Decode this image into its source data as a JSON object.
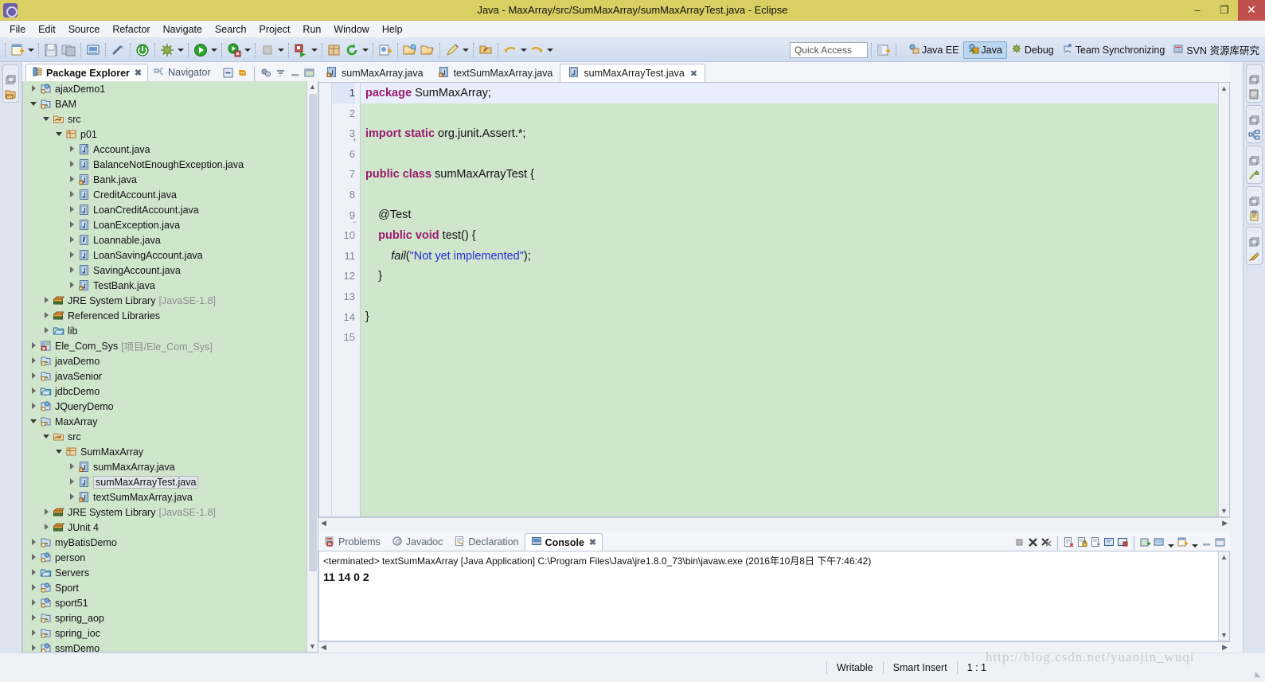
{
  "window": {
    "title": "Java - MaxArray/src/SumMaxArray/sumMaxArrayTest.java - Eclipse",
    "minimize": "–",
    "restore": "❐",
    "close": "✕"
  },
  "menubar": {
    "items": [
      "File",
      "Edit",
      "Source",
      "Refactor",
      "Navigate",
      "Search",
      "Project",
      "Run",
      "Window",
      "Help"
    ]
  },
  "toolbar": {
    "quick_access_placeholder": "Quick Access",
    "perspectives": [
      {
        "label": "Java EE",
        "active": false
      },
      {
        "label": "Java",
        "active": true
      },
      {
        "label": "Debug",
        "active": false
      },
      {
        "label": "Team Synchronizing",
        "active": false
      },
      {
        "label": "SVN 资源库研究",
        "active": false
      }
    ]
  },
  "left_panel": {
    "tabs": [
      {
        "label": "Package Explorer",
        "active": true,
        "closable": true
      },
      {
        "label": "Navigator",
        "active": false,
        "closable": false
      }
    ],
    "tree": [
      {
        "label": "ajaxDemo1",
        "indent": 0,
        "twisty": "closed",
        "icon": "web-project-icon"
      },
      {
        "label": "BAM",
        "indent": 0,
        "twisty": "open",
        "icon": "java-project-icon"
      },
      {
        "label": "src",
        "indent": 1,
        "twisty": "open",
        "icon": "source-folder-icon"
      },
      {
        "label": "p01",
        "indent": 2,
        "twisty": "open",
        "icon": "package-icon"
      },
      {
        "label": "Account.java",
        "indent": 3,
        "twisty": "closed",
        "icon": "java-abstract-file-icon"
      },
      {
        "label": "BalanceNotEnoughException.java",
        "indent": 3,
        "twisty": "closed",
        "icon": "java-file-icon"
      },
      {
        "label": "Bank.java",
        "indent": 3,
        "twisty": "closed",
        "icon": "java-main-file-icon"
      },
      {
        "label": "CreditAccount.java",
        "indent": 3,
        "twisty": "closed",
        "icon": "java-file-icon"
      },
      {
        "label": "LoanCreditAccount.java",
        "indent": 3,
        "twisty": "closed",
        "icon": "java-file-icon"
      },
      {
        "label": "LoanException.java",
        "indent": 3,
        "twisty": "closed",
        "icon": "java-file-icon"
      },
      {
        "label": "Loannable.java",
        "indent": 3,
        "twisty": "closed",
        "icon": "java-interface-file-icon"
      },
      {
        "label": "LoanSavingAccount.java",
        "indent": 3,
        "twisty": "closed",
        "icon": "java-file-icon"
      },
      {
        "label": "SavingAccount.java",
        "indent": 3,
        "twisty": "closed",
        "icon": "java-file-icon"
      },
      {
        "label": "TestBank.java",
        "indent": 3,
        "twisty": "closed",
        "icon": "java-main-file-icon"
      },
      {
        "label": "JRE System Library",
        "sub": "[JavaSE-1.8]",
        "indent": 1,
        "twisty": "closed",
        "icon": "library-icon"
      },
      {
        "label": "Referenced Libraries",
        "indent": 1,
        "twisty": "closed",
        "icon": "library-icon"
      },
      {
        "label": "lib",
        "indent": 1,
        "twisty": "closed",
        "icon": "folder-icon"
      },
      {
        "label": "Ele_Com_Sys",
        "sub": "[项目/Ele_Com_Sys]",
        "indent": 0,
        "twisty": "closed",
        "icon": "error-project-icon"
      },
      {
        "label": "javaDemo",
        "indent": 0,
        "twisty": "closed",
        "icon": "java-project-icon"
      },
      {
        "label": "javaSenior",
        "indent": 0,
        "twisty": "closed",
        "icon": "java-project-icon"
      },
      {
        "label": "jdbcDemo",
        "indent": 0,
        "twisty": "closed",
        "icon": "folder-icon"
      },
      {
        "label": "JQueryDemo",
        "indent": 0,
        "twisty": "closed",
        "icon": "web-project-icon"
      },
      {
        "label": "MaxArray",
        "indent": 0,
        "twisty": "open",
        "icon": "java-project-icon"
      },
      {
        "label": "src",
        "indent": 1,
        "twisty": "open",
        "icon": "source-folder-icon"
      },
      {
        "label": "SumMaxArray",
        "indent": 2,
        "twisty": "open",
        "icon": "package-icon"
      },
      {
        "label": "sumMaxArray.java",
        "indent": 3,
        "twisty": "closed",
        "icon": "java-main-file-icon"
      },
      {
        "label": "sumMaxArrayTest.java",
        "indent": 3,
        "twisty": "closed",
        "icon": "java-file-icon",
        "selected": true
      },
      {
        "label": "textSumMaxArray.java",
        "indent": 3,
        "twisty": "closed",
        "icon": "java-main-file-icon"
      },
      {
        "label": "JRE System Library",
        "sub": "[JavaSE-1.8]",
        "indent": 1,
        "twisty": "closed",
        "icon": "library-icon"
      },
      {
        "label": "JUnit 4",
        "indent": 1,
        "twisty": "closed",
        "icon": "library-icon"
      },
      {
        "label": "myBatisDemo",
        "indent": 0,
        "twisty": "closed",
        "icon": "java-project-icon"
      },
      {
        "label": "person",
        "indent": 0,
        "twisty": "closed",
        "icon": "web-project-icon"
      },
      {
        "label": "Servers",
        "indent": 0,
        "twisty": "closed",
        "icon": "folder-icon"
      },
      {
        "label": "Sport",
        "indent": 0,
        "twisty": "closed",
        "icon": "web-project-icon"
      },
      {
        "label": "sport51",
        "indent": 0,
        "twisty": "closed",
        "icon": "web-project-icon"
      },
      {
        "label": "spring_aop",
        "indent": 0,
        "twisty": "closed",
        "icon": "java-project-icon"
      },
      {
        "label": "spring_ioc",
        "indent": 0,
        "twisty": "closed",
        "icon": "java-project-icon"
      },
      {
        "label": "ssmDemo",
        "indent": 0,
        "twisty": "closed",
        "icon": "web-project-icon"
      }
    ]
  },
  "editor": {
    "tabs": [
      {
        "label": "sumMaxArray.java",
        "active": false,
        "icon": "java-main-file-icon"
      },
      {
        "label": "textSumMaxArray.java",
        "active": false,
        "icon": "java-main-file-icon"
      },
      {
        "label": "sumMaxArrayTest.java",
        "active": true,
        "icon": "java-file-icon",
        "close": "✖"
      }
    ],
    "lines": [
      {
        "num": "1",
        "current": true,
        "fold": "",
        "tokens": [
          {
            "t": "package",
            "c": "kw"
          },
          {
            "t": " SumMaxArray;",
            "c": "plain"
          }
        ]
      },
      {
        "num": "2",
        "current": false,
        "fold": "",
        "tokens": []
      },
      {
        "num": "3",
        "current": false,
        "fold": "+",
        "tokens": [
          {
            "t": "import static",
            "c": "kw"
          },
          {
            "t": " org.junit.Assert.*;",
            "c": "plain"
          }
        ]
      },
      {
        "num": "6",
        "current": false,
        "fold": "",
        "tokens": []
      },
      {
        "num": "7",
        "current": false,
        "fold": "",
        "tokens": [
          {
            "t": "public class",
            "c": "kw"
          },
          {
            "t": " sumMaxArrayTest {",
            "c": "plain"
          }
        ]
      },
      {
        "num": "8",
        "current": false,
        "fold": "",
        "tokens": []
      },
      {
        "num": "9",
        "current": false,
        "fold": "−",
        "tokens": [
          {
            "t": "    @Test",
            "c": "plain"
          }
        ]
      },
      {
        "num": "10",
        "current": false,
        "fold": "",
        "tokens": [
          {
            "t": "    ",
            "c": "plain"
          },
          {
            "t": "public void",
            "c": "kw"
          },
          {
            "t": " test() {",
            "c": "plain"
          }
        ]
      },
      {
        "num": "11",
        "current": false,
        "fold": "",
        "tokens": [
          {
            "t": "        ",
            "c": "plain"
          },
          {
            "t": "fail",
            "c": "ital"
          },
          {
            "t": "(",
            "c": "plain"
          },
          {
            "t": "\"Not yet implemented\"",
            "c": "str"
          },
          {
            "t": ");",
            "c": "plain"
          }
        ]
      },
      {
        "num": "12",
        "current": false,
        "fold": "",
        "tokens": [
          {
            "t": "    }",
            "c": "plain"
          }
        ]
      },
      {
        "num": "13",
        "current": false,
        "fold": "",
        "tokens": []
      },
      {
        "num": "14",
        "current": false,
        "fold": "",
        "tokens": [
          {
            "t": "}",
            "c": "plain"
          }
        ]
      },
      {
        "num": "15",
        "current": false,
        "fold": "",
        "tokens": []
      }
    ]
  },
  "console": {
    "tabs": [
      {
        "label": "Problems",
        "active": false,
        "icon": "problems-icon"
      },
      {
        "label": "Javadoc",
        "active": false,
        "icon": "javadoc-icon"
      },
      {
        "label": "Declaration",
        "active": false,
        "icon": "declaration-icon"
      },
      {
        "label": "Console",
        "active": true,
        "icon": "console-icon",
        "close": "✖"
      }
    ],
    "terminated_line": "<terminated> textSumMaxArray [Java Application] C:\\Program Files\\Java\\jre1.8.0_73\\bin\\javaw.exe (2016年10月8日 下午7:46:42)",
    "output": "11 14 0 2"
  },
  "statusbar": {
    "writable": "Writable",
    "insert_mode": "Smart Insert",
    "position": "1 : 1",
    "watermark": "http://blog.csdn.net/yuanjin_wuqi"
  },
  "colors": {
    "title_bg": "#d9cf62",
    "close_btn": "#c0504d",
    "tree_bg": "#cfe6cd",
    "code_bg": "#cfe6cd",
    "keyword": "#9b1a6e",
    "string": "#2a2ad6",
    "active_persp": "#bcd6f0"
  }
}
